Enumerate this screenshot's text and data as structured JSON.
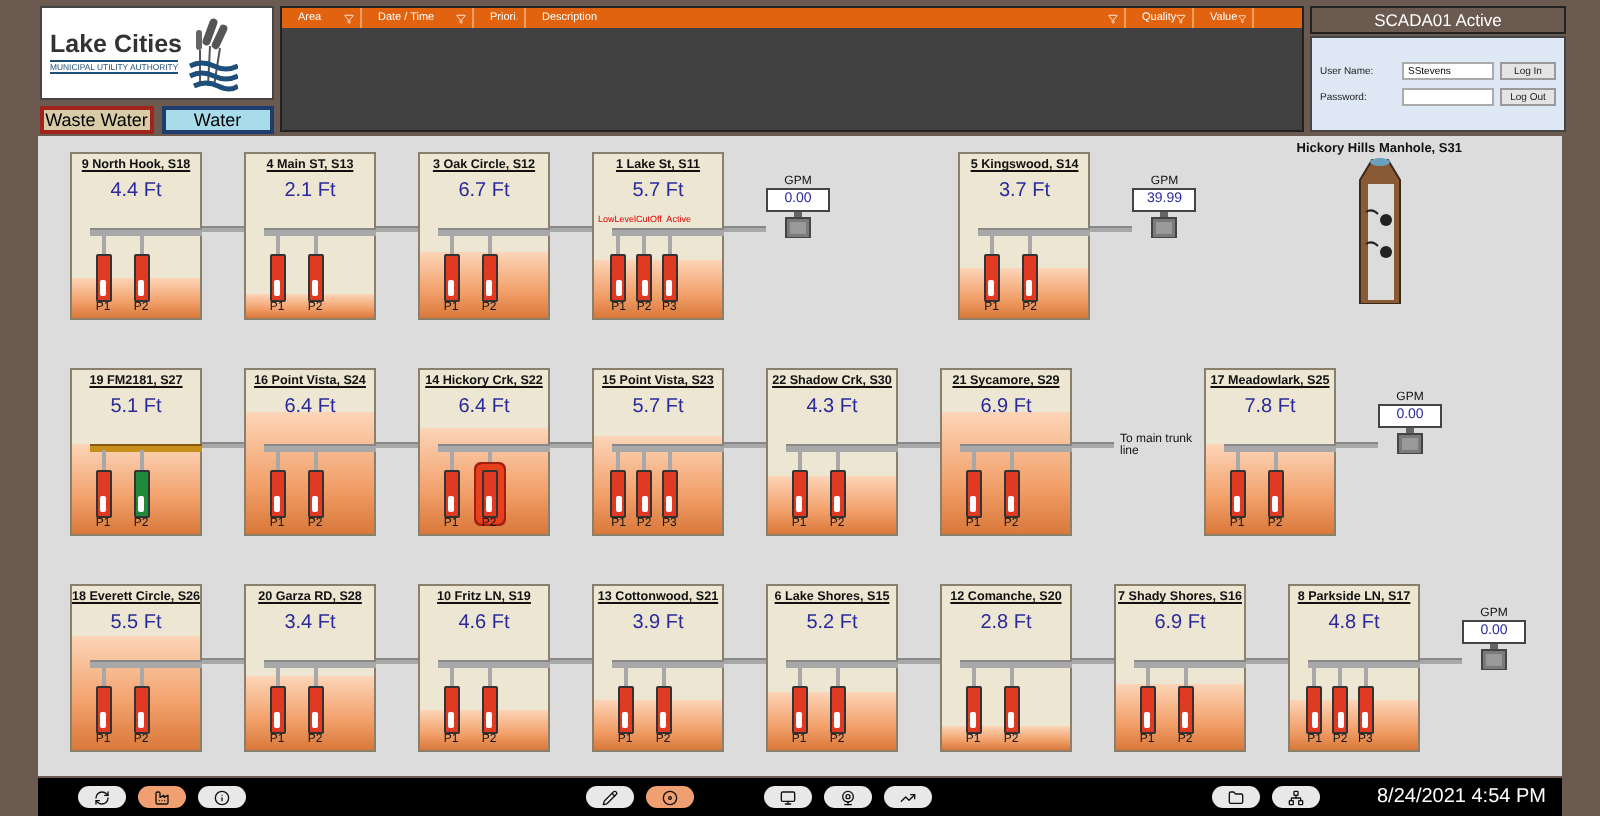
{
  "logo": {
    "name": "Lake Cities",
    "subtitle": "MUNICIPAL UTILITY AUTHORITY"
  },
  "tabs": [
    {
      "label": "Waste Water",
      "selected": true
    },
    {
      "label": "Water",
      "selected": false
    }
  ],
  "alarm_table": {
    "columns": [
      "Area",
      "Date / Time",
      "Priori",
      "Description",
      "Quality",
      "Value"
    ]
  },
  "login": {
    "title": "SCADA01 Active",
    "user_label": "User Name:",
    "user_value": "SStevens",
    "password_label": "Password:",
    "buttons": [
      "Log In",
      "Log Out"
    ]
  },
  "rows": [
    {
      "items": [
        {
          "kind": "station",
          "name": "9 North Hook, S18",
          "reading": "4.4 Ft",
          "level": 0.25,
          "manifold_active": false,
          "pumps": [
            {
              "label": "P1",
              "running": false,
              "fault": false
            },
            {
              "label": "P2",
              "running": false,
              "fault": false
            }
          ]
        },
        {
          "kind": "station",
          "name": "4 Main ST, S13",
          "reading": "2.1 Ft",
          "level": 0.15,
          "manifold_active": false,
          "pumps": [
            {
              "label": "P1",
              "running": false,
              "fault": false
            },
            {
              "label": "P2",
              "running": false,
              "fault": false
            }
          ]
        },
        {
          "kind": "station",
          "name": "3 Oak Circle, S12",
          "reading": "6.7 Ft",
          "level": 0.4,
          "manifold_active": false,
          "pumps": [
            {
              "label": "P1",
              "running": false,
              "fault": false
            },
            {
              "label": "P2",
              "running": false,
              "fault": false
            }
          ]
        },
        {
          "kind": "station",
          "name": "1 Lake St, S11",
          "reading": "5.7 Ft",
          "level": 0.35,
          "manifold_active": false,
          "alarm": "LowLevelCutOff  Active",
          "pumps": [
            {
              "label": "P1",
              "running": false,
              "fault": false
            },
            {
              "label": "P2",
              "running": false,
              "fault": false
            },
            {
              "label": "P3",
              "running": false,
              "fault": false
            }
          ]
        },
        {
          "kind": "meter",
          "label": "GPM",
          "value": "0.00"
        },
        {
          "kind": "station",
          "name": "5 Kingswood, S14",
          "reading": "3.7 Ft",
          "level": 0.3,
          "manifold_active": false,
          "pumps": [
            {
              "label": "P1",
              "running": false,
              "fault": false
            },
            {
              "label": "P2",
              "running": false,
              "fault": false
            }
          ]
        },
        {
          "kind": "meter",
          "label": "GPM",
          "value": "39.99"
        },
        {
          "kind": "manhole",
          "name": "Hickory Hills Manhole, S31"
        }
      ]
    },
    {
      "items": [
        {
          "kind": "station",
          "name": "19 FM2181, S27",
          "reading": "5.1 Ft",
          "level": 0.55,
          "manifold_active": true,
          "pumps": [
            {
              "label": "P1",
              "running": false,
              "fault": false
            },
            {
              "label": "P2",
              "running": true,
              "fault": false
            }
          ]
        },
        {
          "kind": "station",
          "name": "16 Point Vista, S24",
          "reading": "6.4 Ft",
          "level": 0.75,
          "manifold_active": false,
          "pumps": [
            {
              "label": "P1",
              "running": false,
              "fault": false
            },
            {
              "label": "P2",
              "running": false,
              "fault": false
            }
          ]
        },
        {
          "kind": "station",
          "name": "14 Hickory Crk, S22",
          "reading": "6.4 Ft",
          "level": 0.65,
          "manifold_active": false,
          "pumps": [
            {
              "label": "P1",
              "running": false,
              "fault": false
            },
            {
              "label": "P2",
              "running": false,
              "fault": true
            }
          ]
        },
        {
          "kind": "station",
          "name": "15 Point Vista, S23",
          "reading": "5.7 Ft",
          "level": 0.6,
          "manifold_active": false,
          "pumps": [
            {
              "label": "P1",
              "running": false,
              "fault": false
            },
            {
              "label": "P2",
              "running": false,
              "fault": false
            },
            {
              "label": "P3",
              "running": false,
              "fault": false
            }
          ]
        },
        {
          "kind": "station",
          "name": "22 Shadow Crk, S30",
          "reading": "4.3 Ft",
          "level": 0.35,
          "manifold_active": false,
          "pumps": [
            {
              "label": "P1",
              "running": false,
              "fault": false
            },
            {
              "label": "P2",
              "running": false,
              "fault": false
            }
          ]
        },
        {
          "kind": "station",
          "name": "21 Sycamore, S29",
          "reading": "6.9 Ft",
          "level": 0.75,
          "manifold_active": false,
          "pumps": [
            {
              "label": "P1",
              "running": false,
              "fault": false
            },
            {
              "label": "P2",
              "running": false,
              "fault": false
            }
          ]
        },
        {
          "kind": "note",
          "text": "To main trunk line"
        },
        {
          "kind": "station",
          "name": "17 Meadowlark, S25",
          "reading": "7.8 Ft",
          "level": 0.55,
          "manifold_active": false,
          "pumps": [
            {
              "label": "P1",
              "running": false,
              "fault": false
            },
            {
              "label": "P2",
              "running": false,
              "fault": false
            }
          ]
        },
        {
          "kind": "meter",
          "label": "GPM",
          "value": "0.00"
        }
      ]
    },
    {
      "items": [
        {
          "kind": "station",
          "name": "18 Everett Circle, S26",
          "reading": "5.5 Ft",
          "level": 0.7,
          "manifold_active": false,
          "pumps": [
            {
              "label": "P1",
              "running": false,
              "fault": false
            },
            {
              "label": "P2",
              "running": false,
              "fault": false
            }
          ]
        },
        {
          "kind": "station",
          "name": "20 Garza RD, S28",
          "reading": "3.4 Ft",
          "level": 0.45,
          "manifold_active": false,
          "pumps": [
            {
              "label": "P1",
              "running": false,
              "fault": false
            },
            {
              "label": "P2",
              "running": false,
              "fault": false
            }
          ]
        },
        {
          "kind": "station",
          "name": "10 Fritz LN, S19",
          "reading": "4.6 Ft",
          "level": 0.25,
          "manifold_active": false,
          "pumps": [
            {
              "label": "P1",
              "running": false,
              "fault": false
            },
            {
              "label": "P2",
              "running": false,
              "fault": false
            }
          ]
        },
        {
          "kind": "station",
          "name": "13 Cottonwood, S21",
          "reading": "3.9 Ft",
          "level": 0.3,
          "manifold_active": false,
          "pumps": [
            {
              "label": "P1",
              "running": false,
              "fault": false
            },
            {
              "label": "P2",
              "running": false,
              "fault": false
            }
          ]
        },
        {
          "kind": "station",
          "name": "6 Lake Shores, S15",
          "reading": "5.2 Ft",
          "level": 0.35,
          "manifold_active": false,
          "pumps": [
            {
              "label": "P1",
              "running": false,
              "fault": false
            },
            {
              "label": "P2",
              "running": false,
              "fault": false
            }
          ]
        },
        {
          "kind": "station",
          "name": "12 Comanche, S20",
          "reading": "2.8 Ft",
          "level": 0.15,
          "manifold_active": false,
          "pumps": [
            {
              "label": "P1",
              "running": false,
              "fault": false
            },
            {
              "label": "P2",
              "running": false,
              "fault": false
            }
          ]
        },
        {
          "kind": "station",
          "name": "7 Shady Shores, S16",
          "reading": "6.9 Ft",
          "level": 0.4,
          "manifold_active": false,
          "pumps": [
            {
              "label": "P1",
              "running": false,
              "fault": false
            },
            {
              "label": "P2",
              "running": false,
              "fault": false
            }
          ]
        },
        {
          "kind": "station",
          "name": "8 Parkside LN, S17",
          "reading": "4.8 Ft",
          "level": 0.3,
          "manifold_active": false,
          "pumps": [
            {
              "label": "P1",
              "running": false,
              "fault": false
            },
            {
              "label": "P2",
              "running": false,
              "fault": false
            },
            {
              "label": "P3",
              "running": false,
              "fault": false
            }
          ]
        },
        {
          "kind": "meter",
          "label": "GPM",
          "value": "0.00"
        }
      ]
    }
  ],
  "toolbar": [
    {
      "buttons": [
        {
          "selected": false
        },
        {
          "selected": true
        },
        {
          "selected": false
        }
      ]
    },
    {
      "buttons": [
        {
          "selected": false
        },
        {
          "selected": true
        }
      ]
    },
    {
      "buttons": [
        {
          "selected": false
        },
        {
          "selected": false
        },
        {
          "selected": false
        }
      ]
    },
    {
      "buttons": [
        {
          "selected": false
        },
        {
          "selected": false
        }
      ]
    }
  ],
  "datetime": "8/24/2021 4:54 PM"
}
